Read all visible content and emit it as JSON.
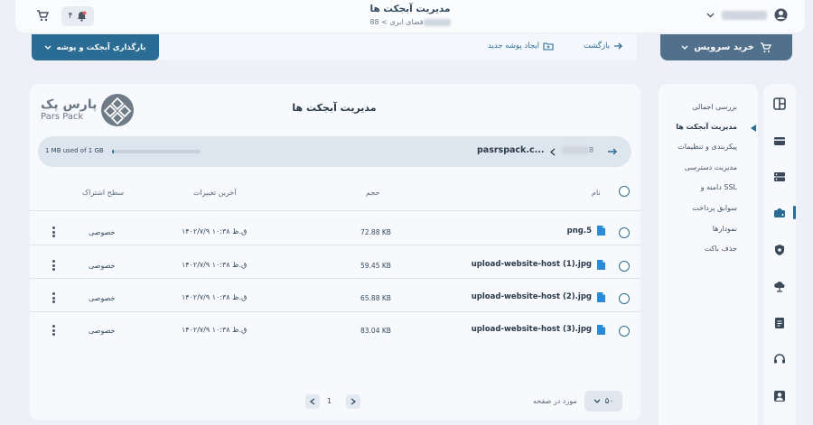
{
  "header": {
    "title": "مدیریت آبجکت ها",
    "crumb_root": "فضای ابری",
    "crumb_sep": ">",
    "crumb_id_suffix": "88",
    "cart_count": "۴",
    "user_name": "کاربر"
  },
  "toolbar": {
    "upload_label": "بارگذاری آبجکت و پوشه",
    "new_folder_label": "ایجاد پوشه جدید",
    "back_label": "بازگشت",
    "buy_label": "خرید سرویس"
  },
  "sidemenu": {
    "items": [
      {
        "label": "بررسی اجمالی"
      },
      {
        "label": "مدیریت آبجکت ها"
      },
      {
        "label": "پیکربندی و تنظیمات"
      },
      {
        "label": "مدیریت دسترسی"
      },
      {
        "label": "دامنه و SSL"
      },
      {
        "label": "سوابق پرداخت"
      },
      {
        "label": "نمودارها"
      },
      {
        "label": "حذف باکت"
      }
    ]
  },
  "main": {
    "title": "مدیریت آبجکت ها",
    "logo_fa": "پارس پک",
    "logo_en": "Pars Pack",
    "usage_text": "1 MB used of 1 GB",
    "usage_fraction": 0.001,
    "path_bucket": "pasrspack.c...",
    "path_id_suffix": "8",
    "columns": {
      "name": "نام",
      "size": "حجم",
      "modified": "آخرین تغییرات",
      "access": "سطح اشتراک"
    },
    "rows": [
      {
        "name": "png.5",
        "size": "72.88 KB",
        "modified": "۱۴۰۲/۷/۹ ۱۰:۳۸ ق.ظ",
        "access": "خصوصی"
      },
      {
        "name": "upload-website-host (1).jpg",
        "size": "59.45 KB",
        "modified": "۱۴۰۲/۷/۹ ۱۰:۳۸ ق.ظ",
        "access": "خصوصی"
      },
      {
        "name": "upload-website-host (2).jpg",
        "size": "65.88 KB",
        "modified": "۱۴۰۲/۷/۹ ۱۰:۳۸ ق.ظ",
        "access": "خصوصی"
      },
      {
        "name": "upload-website-host (3).jpg",
        "size": "83.04 KB",
        "modified": "۱۴۰۲/۷/۹ ۱۰:۳۸ ق.ظ",
        "access": "خصوصی"
      }
    ],
    "per_page_value": "۵۰",
    "per_page_label": "مورد در صفحه",
    "page_number": "1"
  },
  "colors": {
    "primary": "#2b6c95",
    "buy": "#51708c",
    "bg": "#edf1f7"
  }
}
